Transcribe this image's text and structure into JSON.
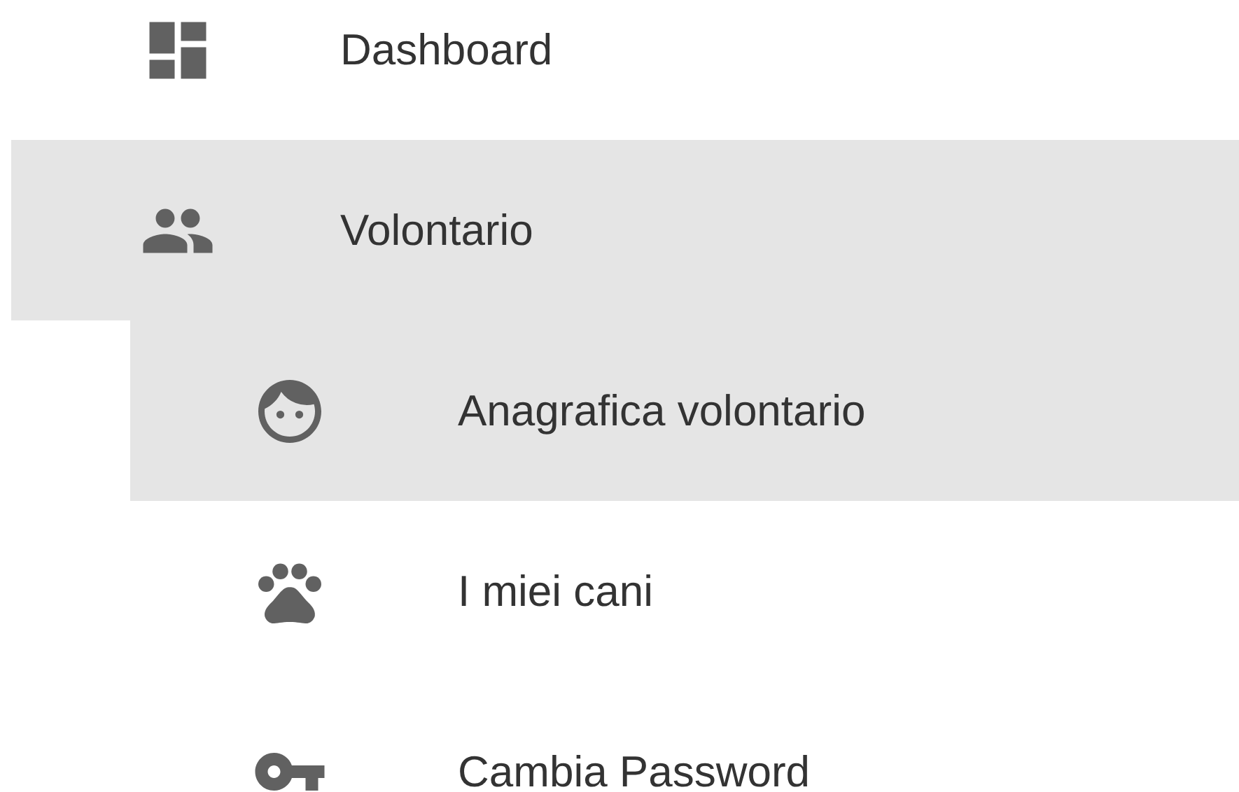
{
  "menu": [
    {
      "label": "Dashboard",
      "selected": false
    },
    {
      "label": "Volontario",
      "selected": true,
      "expanded": true,
      "children": [
        {
          "label": "Anagrafica volontario",
          "selected": true
        },
        {
          "label": "I miei cani",
          "selected": false
        },
        {
          "label": "Cambia Password",
          "selected": false
        }
      ]
    }
  ]
}
